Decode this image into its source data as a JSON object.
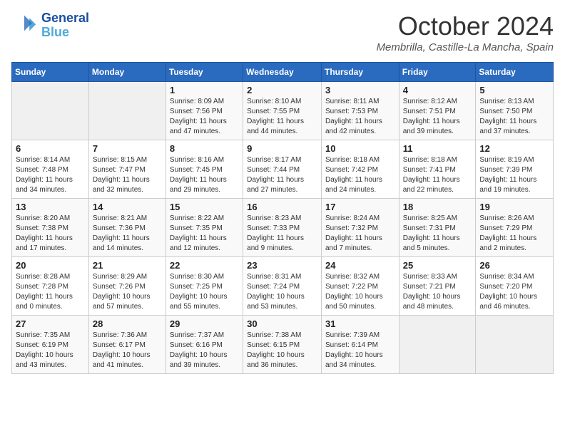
{
  "header": {
    "logo_line1": "General",
    "logo_line2": "Blue",
    "month": "October 2024",
    "location": "Membrilla, Castille-La Mancha, Spain"
  },
  "weekdays": [
    "Sunday",
    "Monday",
    "Tuesday",
    "Wednesday",
    "Thursday",
    "Friday",
    "Saturday"
  ],
  "weeks": [
    [
      {
        "day": "",
        "info": ""
      },
      {
        "day": "",
        "info": ""
      },
      {
        "day": "1",
        "info": "Sunrise: 8:09 AM\nSunset: 7:56 PM\nDaylight: 11 hours and 47 minutes."
      },
      {
        "day": "2",
        "info": "Sunrise: 8:10 AM\nSunset: 7:55 PM\nDaylight: 11 hours and 44 minutes."
      },
      {
        "day": "3",
        "info": "Sunrise: 8:11 AM\nSunset: 7:53 PM\nDaylight: 11 hours and 42 minutes."
      },
      {
        "day": "4",
        "info": "Sunrise: 8:12 AM\nSunset: 7:51 PM\nDaylight: 11 hours and 39 minutes."
      },
      {
        "day": "5",
        "info": "Sunrise: 8:13 AM\nSunset: 7:50 PM\nDaylight: 11 hours and 37 minutes."
      }
    ],
    [
      {
        "day": "6",
        "info": "Sunrise: 8:14 AM\nSunset: 7:48 PM\nDaylight: 11 hours and 34 minutes."
      },
      {
        "day": "7",
        "info": "Sunrise: 8:15 AM\nSunset: 7:47 PM\nDaylight: 11 hours and 32 minutes."
      },
      {
        "day": "8",
        "info": "Sunrise: 8:16 AM\nSunset: 7:45 PM\nDaylight: 11 hours and 29 minutes."
      },
      {
        "day": "9",
        "info": "Sunrise: 8:17 AM\nSunset: 7:44 PM\nDaylight: 11 hours and 27 minutes."
      },
      {
        "day": "10",
        "info": "Sunrise: 8:18 AM\nSunset: 7:42 PM\nDaylight: 11 hours and 24 minutes."
      },
      {
        "day": "11",
        "info": "Sunrise: 8:18 AM\nSunset: 7:41 PM\nDaylight: 11 hours and 22 minutes."
      },
      {
        "day": "12",
        "info": "Sunrise: 8:19 AM\nSunset: 7:39 PM\nDaylight: 11 hours and 19 minutes."
      }
    ],
    [
      {
        "day": "13",
        "info": "Sunrise: 8:20 AM\nSunset: 7:38 PM\nDaylight: 11 hours and 17 minutes."
      },
      {
        "day": "14",
        "info": "Sunrise: 8:21 AM\nSunset: 7:36 PM\nDaylight: 11 hours and 14 minutes."
      },
      {
        "day": "15",
        "info": "Sunrise: 8:22 AM\nSunset: 7:35 PM\nDaylight: 11 hours and 12 minutes."
      },
      {
        "day": "16",
        "info": "Sunrise: 8:23 AM\nSunset: 7:33 PM\nDaylight: 11 hours and 9 minutes."
      },
      {
        "day": "17",
        "info": "Sunrise: 8:24 AM\nSunset: 7:32 PM\nDaylight: 11 hours and 7 minutes."
      },
      {
        "day": "18",
        "info": "Sunrise: 8:25 AM\nSunset: 7:31 PM\nDaylight: 11 hours and 5 minutes."
      },
      {
        "day": "19",
        "info": "Sunrise: 8:26 AM\nSunset: 7:29 PM\nDaylight: 11 hours and 2 minutes."
      }
    ],
    [
      {
        "day": "20",
        "info": "Sunrise: 8:28 AM\nSunset: 7:28 PM\nDaylight: 11 hours and 0 minutes."
      },
      {
        "day": "21",
        "info": "Sunrise: 8:29 AM\nSunset: 7:26 PM\nDaylight: 10 hours and 57 minutes."
      },
      {
        "day": "22",
        "info": "Sunrise: 8:30 AM\nSunset: 7:25 PM\nDaylight: 10 hours and 55 minutes."
      },
      {
        "day": "23",
        "info": "Sunrise: 8:31 AM\nSunset: 7:24 PM\nDaylight: 10 hours and 53 minutes."
      },
      {
        "day": "24",
        "info": "Sunrise: 8:32 AM\nSunset: 7:22 PM\nDaylight: 10 hours and 50 minutes."
      },
      {
        "day": "25",
        "info": "Sunrise: 8:33 AM\nSunset: 7:21 PM\nDaylight: 10 hours and 48 minutes."
      },
      {
        "day": "26",
        "info": "Sunrise: 8:34 AM\nSunset: 7:20 PM\nDaylight: 10 hours and 46 minutes."
      }
    ],
    [
      {
        "day": "27",
        "info": "Sunrise: 7:35 AM\nSunset: 6:19 PM\nDaylight: 10 hours and 43 minutes."
      },
      {
        "day": "28",
        "info": "Sunrise: 7:36 AM\nSunset: 6:17 PM\nDaylight: 10 hours and 41 minutes."
      },
      {
        "day": "29",
        "info": "Sunrise: 7:37 AM\nSunset: 6:16 PM\nDaylight: 10 hours and 39 minutes."
      },
      {
        "day": "30",
        "info": "Sunrise: 7:38 AM\nSunset: 6:15 PM\nDaylight: 10 hours and 36 minutes."
      },
      {
        "day": "31",
        "info": "Sunrise: 7:39 AM\nSunset: 6:14 PM\nDaylight: 10 hours and 34 minutes."
      },
      {
        "day": "",
        "info": ""
      },
      {
        "day": "",
        "info": ""
      }
    ]
  ]
}
